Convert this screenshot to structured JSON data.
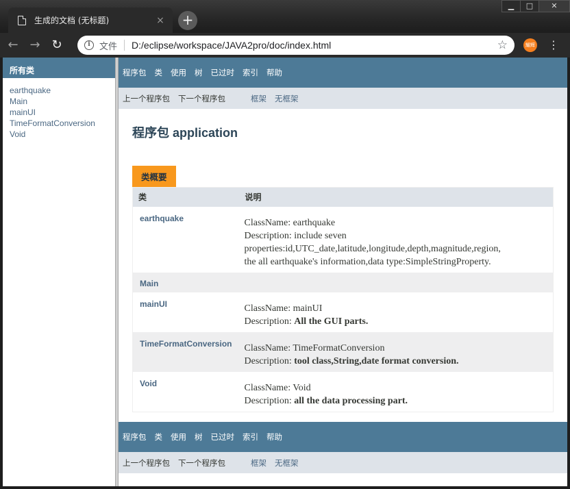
{
  "browser": {
    "tab_title": "生成的文档 (无标题)",
    "tab_close": "×",
    "new_tab": "+",
    "window_controls": {
      "minimize": "▁",
      "maximize": "□",
      "close": "✕"
    },
    "back": "←",
    "forward": "→",
    "reload": "↻",
    "scheme_label": "文件",
    "url": "D:/eclipse/workspace/JAVA2pro/doc/index.html",
    "bookmark": "☆",
    "profile": "耀辉",
    "menu": "⋮",
    "accent_color": "#f47f1f"
  },
  "left_frame": {
    "heading": "所有类",
    "classes": [
      "earthquake",
      "Main",
      "mainUI",
      "TimeFormatConversion",
      "Void"
    ]
  },
  "nav": {
    "items": [
      "程序包",
      "类",
      "使用",
      "树",
      "已过时",
      "索引",
      "帮助"
    ],
    "prev_package": "上一个程序包",
    "next_package": "下一个程序包",
    "frames": "框架",
    "no_frames": "无框架"
  },
  "main": {
    "title": "程序包 application",
    "caption": "类概要",
    "columns": [
      "类",
      "说明"
    ],
    "rows": [
      {
        "name": "earthquake",
        "desc_line1": "ClassName: earthquake",
        "desc_line2": "Description: include seven",
        "desc_line3": "properties:id,UTC_date,latitude,longitude,depth,magnitude,region,",
        "desc_line4": "the all earthquake's information,data type:SimpleStringProperty."
      },
      {
        "name": "Main"
      },
      {
        "name": "mainUI",
        "desc_line1": "ClassName: mainUI",
        "desc_prefix": "Description: ",
        "desc_bold": "All the GUI parts."
      },
      {
        "name": "TimeFormatConversion",
        "desc_line1": "ClassName: TimeFormatConversion",
        "desc_prefix": "Description: ",
        "desc_bold": "tool class,String,date format conversion."
      },
      {
        "name": "Void",
        "desc_line1": "ClassName: Void",
        "desc_prefix": "Description: ",
        "desc_bold": "all the data processing part."
      }
    ]
  },
  "colors": {
    "nav_bar": "#4d7a97",
    "sub_nav": "#dee3e9",
    "caption": "#f8981d",
    "link": "#4a6782"
  }
}
